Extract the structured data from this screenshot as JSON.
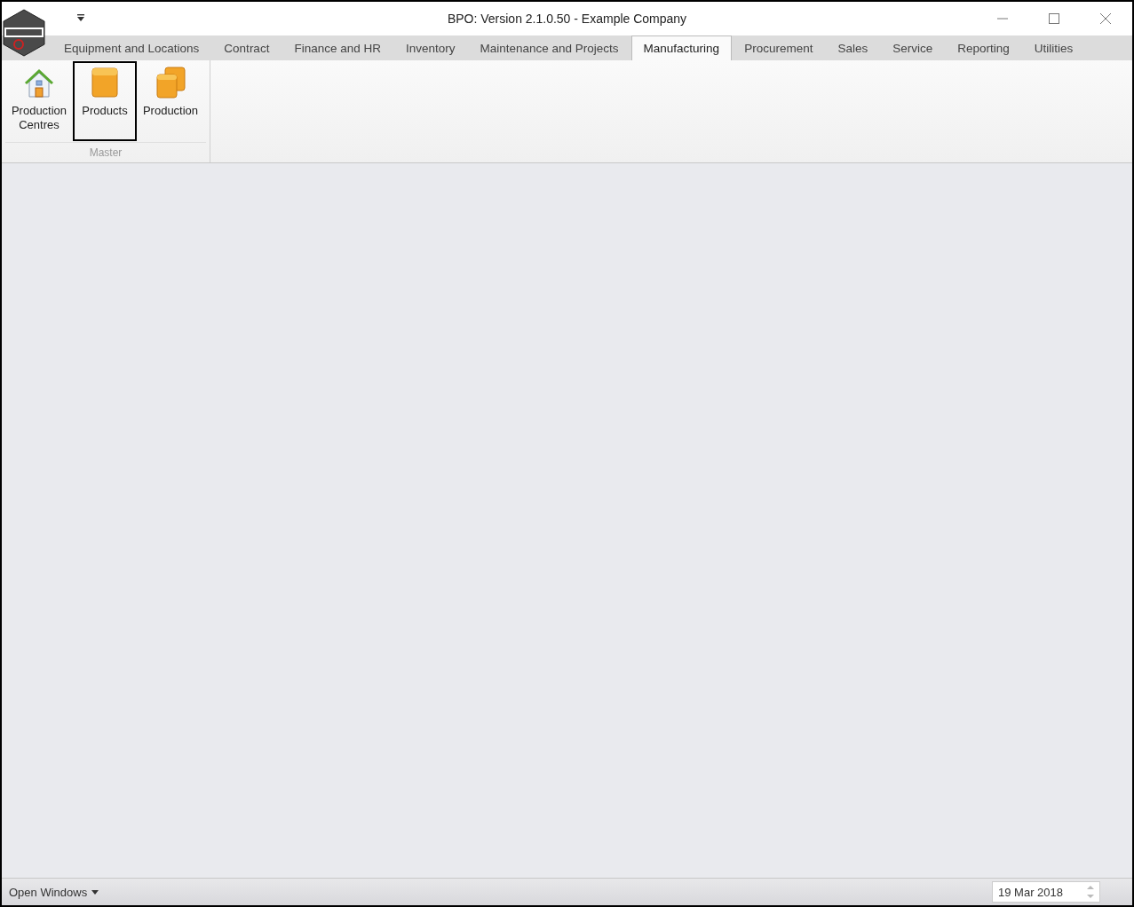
{
  "window": {
    "title": "BPO: Version 2.1.0.50 - Example Company"
  },
  "tabs": [
    {
      "label": "Equipment and Locations",
      "selected": false
    },
    {
      "label": "Contract",
      "selected": false
    },
    {
      "label": "Finance and HR",
      "selected": false
    },
    {
      "label": "Inventory",
      "selected": false
    },
    {
      "label": "Maintenance and Projects",
      "selected": false
    },
    {
      "label": "Manufacturing",
      "selected": true
    },
    {
      "label": "Procurement",
      "selected": false
    },
    {
      "label": "Sales",
      "selected": false
    },
    {
      "label": "Service",
      "selected": false
    },
    {
      "label": "Reporting",
      "selected": false
    },
    {
      "label": "Utilities",
      "selected": false
    }
  ],
  "ribbon": {
    "group": "Master",
    "buttons": [
      {
        "kind": "house",
        "label": "Production Centres",
        "highlighted": false
      },
      {
        "kind": "box",
        "label": "Products",
        "highlighted": true
      },
      {
        "kind": "boxes",
        "label": "Production",
        "highlighted": false
      }
    ]
  },
  "status_bar": {
    "menu": "Open Windows",
    "date": "19 Mar 2018"
  }
}
